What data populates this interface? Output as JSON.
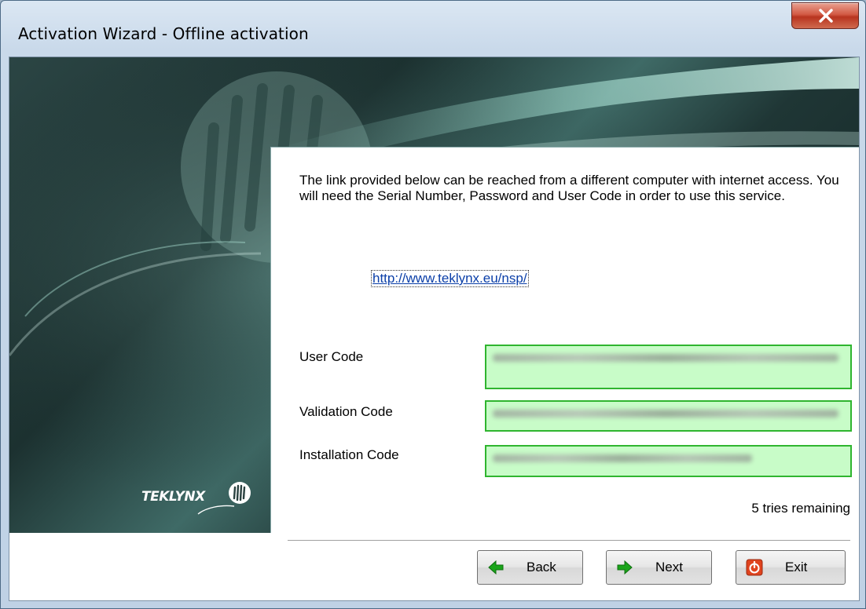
{
  "window": {
    "title": "Activation Wizard - Offline activation",
    "close_glyph": "X"
  },
  "branding": {
    "logo_text": "TEKLYNX"
  },
  "content": {
    "intro": "The link provided below can be reached from a different computer with internet access. You will need the Serial Number, Password and User Code in order to use this service.",
    "link": "http://www.teklynx.eu/nsp/",
    "fields": {
      "user_code_label": "User Code",
      "validation_code_label": "Validation Code",
      "installation_code_label": "Installation Code"
    },
    "tries": "5 tries remaining"
  },
  "buttons": {
    "back": "Back",
    "next": "Next",
    "exit": "Exit"
  },
  "colors": {
    "code_box_fill": "#c8fcc8",
    "code_box_border": "#2fb52f",
    "arrow_green": "#1aa51a",
    "exit_red": "#e0431e"
  }
}
